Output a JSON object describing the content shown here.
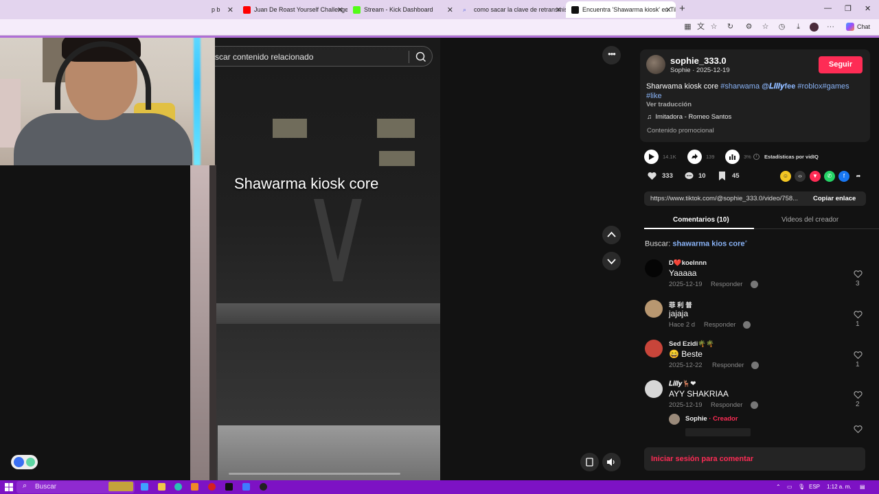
{
  "browser": {
    "tabs": [
      {
        "label": "p b",
        "favicon_color": "#3b82f6"
      },
      {
        "label": "Juan De Roast Yourself Challenge",
        "favicon_color": "#ff0000"
      },
      {
        "label": "Stream - Kick Dashboard",
        "favicon_color": "#53fc18"
      },
      {
        "label": "como sacar la clave de retransmisi",
        "favicon_color": "#5a6be0"
      },
      {
        "label": "Encuentra 'Shawarma kiosk' en Tik",
        "favicon_color": "#111111"
      }
    ],
    "chat_label": "Chat"
  },
  "video": {
    "search_placeholder": "scar contenido relacionado",
    "overlay_title": "Shawarma kiosk core"
  },
  "post": {
    "username": "sophie_333.0",
    "display_and_date": "Sophie · 2025-12-19",
    "follow_label": "Seguir",
    "desc_text": "Sharwama kiosk core",
    "tags": [
      "#sharwama",
      "@𝑳𝒊𝒍𝒍𝒚fee",
      "#roblox",
      "#games",
      "#like"
    ],
    "translate_label": "Ver traducción",
    "music": "Imitadora - Romeo Santos",
    "promo_label": "Contenido promocional"
  },
  "stats": {
    "plays": "14.1K",
    "shares": "139",
    "percent": "3%",
    "vidiq_label": "Estadísticas por vidIQ",
    "likes": "333",
    "comments": "10",
    "saves": "45"
  },
  "link": {
    "url": "https://www.tiktok.com/@sophie_333.0/video/758...",
    "copy_label": "Copiar enlace"
  },
  "tabs": {
    "comments": "Comentarios (10)",
    "creator_videos": "Videos del creador"
  },
  "related_search": {
    "prefix": "Buscar:",
    "query": "shawarma kios core"
  },
  "comments": [
    {
      "user": "D❤️koelnnn",
      "text": "Yaaaaa",
      "date": "2025-12-19",
      "reply": "Responder",
      "likes": "3",
      "avatar_color": "#050505"
    },
    {
      "user": "菲 利 普",
      "text": "jajaja",
      "date": "Hace 2 d",
      "reply": "Responder",
      "likes": "1",
      "avatar_color": "#b89770"
    },
    {
      "user": "Sed Ezidi🌴🌴",
      "text": "😄 Beste",
      "date": "2025-12-22",
      "reply": "Responder",
      "likes": "1",
      "avatar_color": "#c8453a"
    },
    {
      "user": "𝑳𝒊𝒍𝒍𝒚🦌❤",
      "text": "AYY SHAKRIAA",
      "date": "2025-12-19",
      "reply": "Responder",
      "likes": "2",
      "avatar_color": "#d7d7d7"
    }
  ],
  "reply_preview": {
    "user": "Sophie",
    "separator": "·",
    "badge": "Creador"
  },
  "login_label": "Iniciar sesión para comentar",
  "taskbar": {
    "search_label": "Buscar",
    "lang": "ESP",
    "time": "1:12 a. m."
  },
  "colors": {
    "accent": "#fe2c55",
    "link": "#8ab4f8",
    "taskbar": "#7d12c4"
  }
}
